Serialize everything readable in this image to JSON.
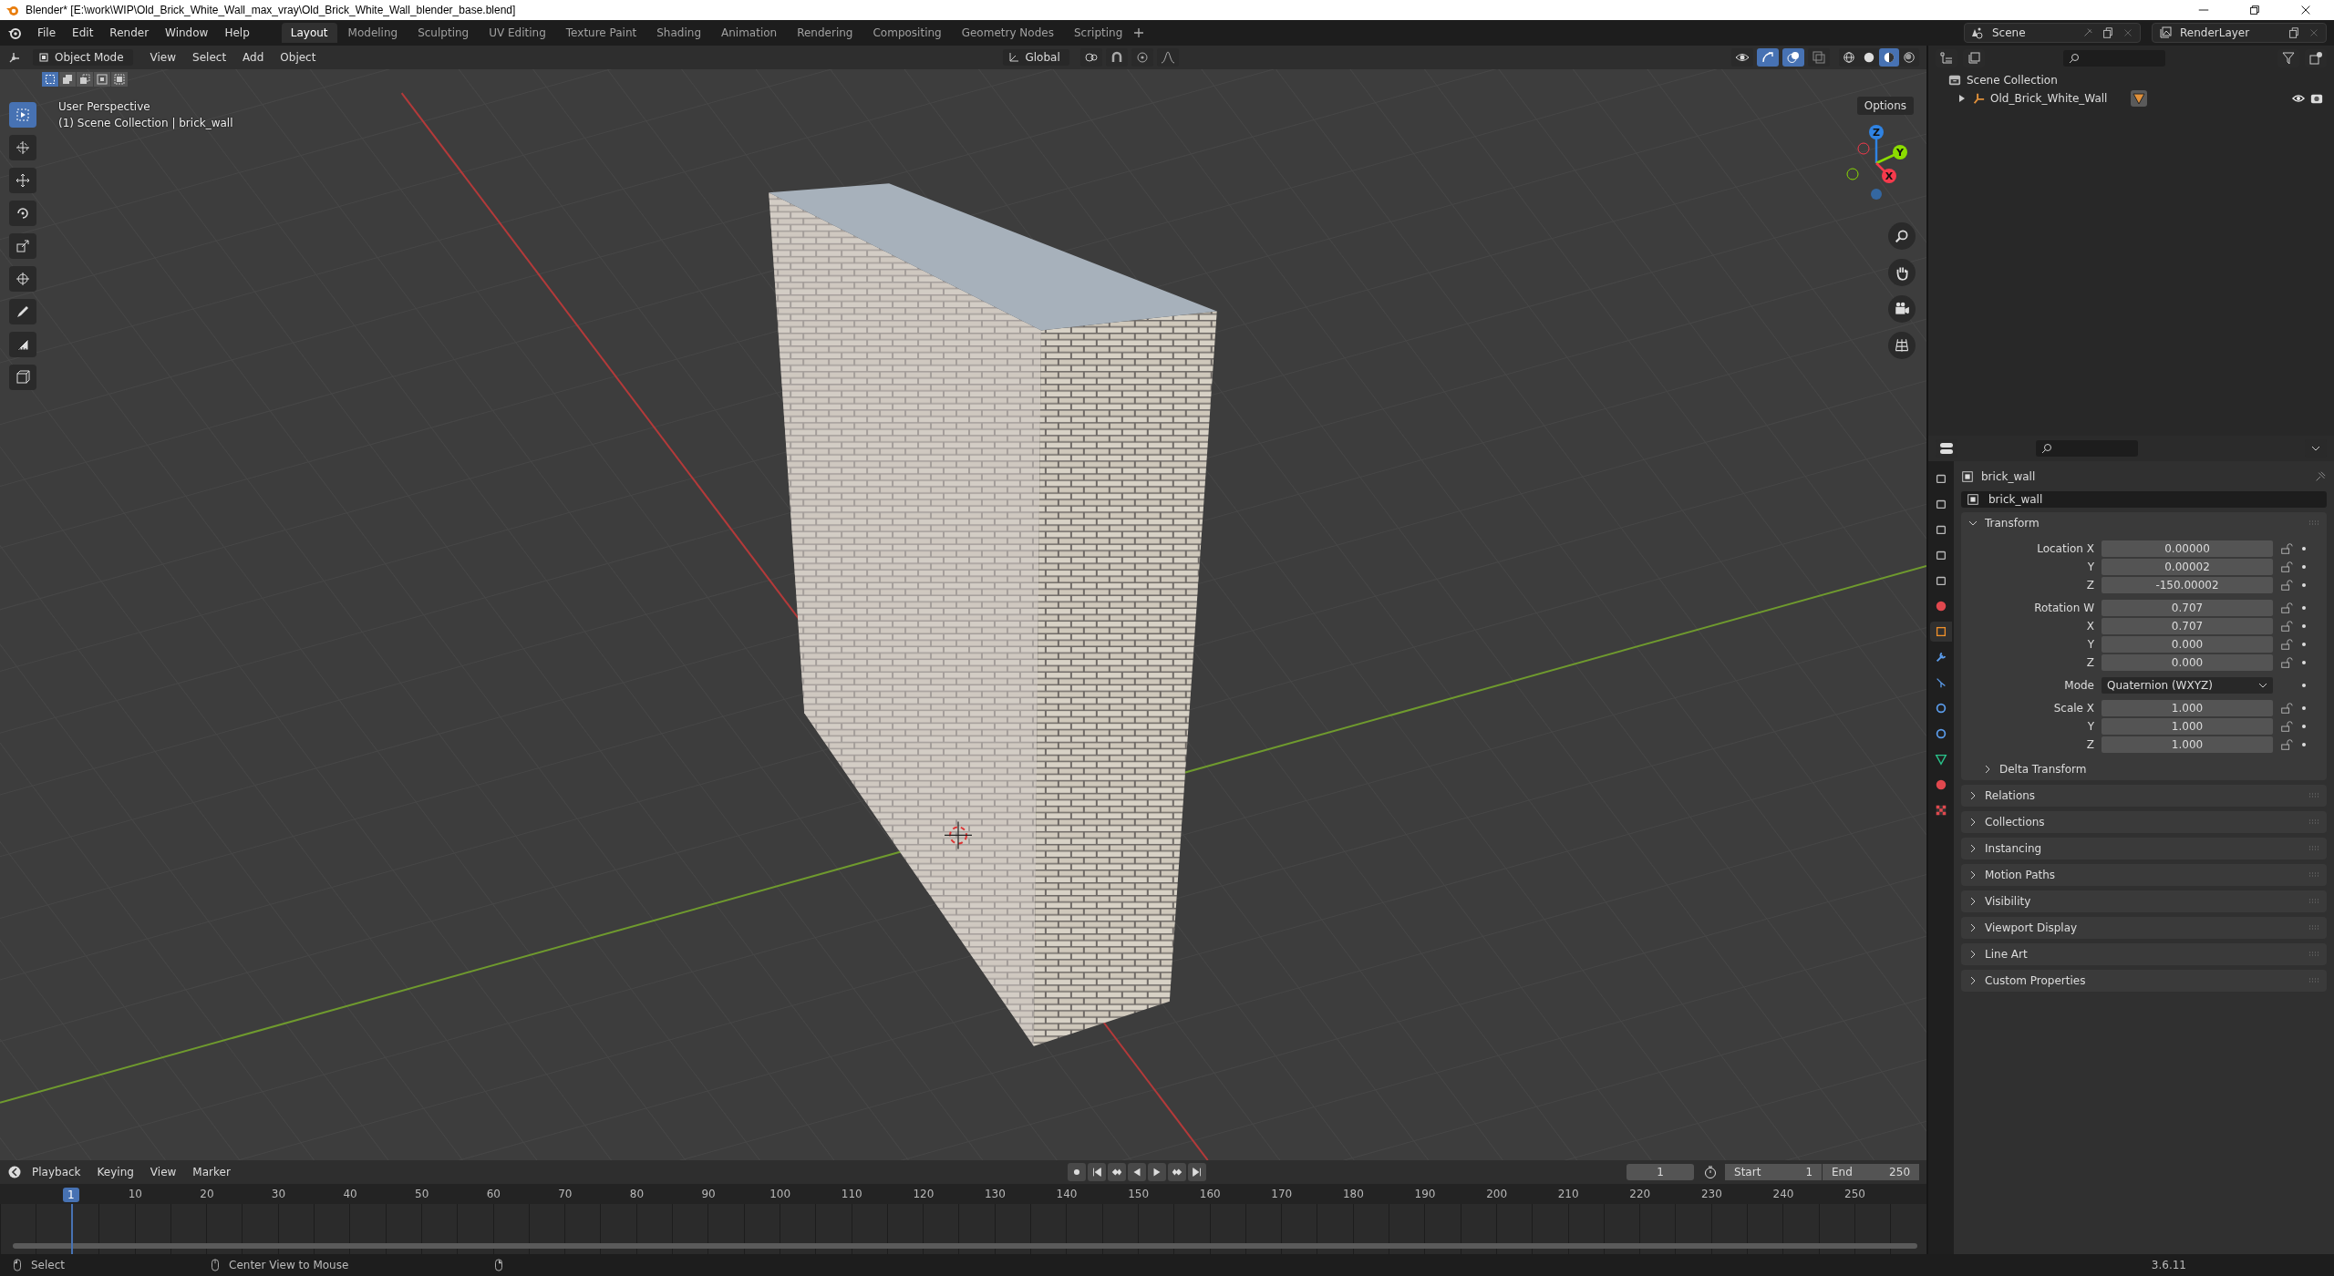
{
  "window": {
    "title": "Blender* [E:\\work\\WIP\\Old_Brick_White_Wall_max_vray\\Old_Brick_White_Wall_blender_base.blend]"
  },
  "menu": [
    "File",
    "Edit",
    "Render",
    "Window",
    "Help"
  ],
  "workspaces": [
    {
      "label": "Layout",
      "selected": true
    },
    {
      "label": "Modeling",
      "selected": false
    },
    {
      "label": "Sculpting",
      "selected": false
    },
    {
      "label": "UV Editing",
      "selected": false
    },
    {
      "label": "Texture Paint",
      "selected": false
    },
    {
      "label": "Shading",
      "selected": false
    },
    {
      "label": "Animation",
      "selected": false
    },
    {
      "label": "Rendering",
      "selected": false
    },
    {
      "label": "Compositing",
      "selected": false
    },
    {
      "label": "Geometry Nodes",
      "selected": false
    },
    {
      "label": "Scripting",
      "selected": false
    }
  ],
  "scene": "Scene",
  "view_layer": "RenderLayer",
  "viewport": {
    "mode": "Object Mode",
    "menus": [
      "View",
      "Select",
      "Add",
      "Object"
    ],
    "orientation": "Global",
    "options": "Options",
    "select_modes": [
      {
        "kind": "set",
        "selected": true
      },
      {
        "kind": "extend",
        "selected": false
      },
      {
        "kind": "subtract",
        "selected": false
      },
      {
        "kind": "difference",
        "selected": false
      },
      {
        "kind": "intersect",
        "selected": false
      }
    ],
    "shading": [
      {
        "kind": "wireframe",
        "selected": false
      },
      {
        "kind": "solid",
        "selected": false
      },
      {
        "kind": "material",
        "selected": true
      },
      {
        "kind": "rendered",
        "selected": false
      }
    ],
    "info": [
      "User Perspective",
      "(1) Scene Collection | brick_wall"
    ],
    "tools": [
      {
        "kind": "select",
        "selected": true
      },
      {
        "kind": "cursor",
        "selected": false
      },
      {
        "kind": "move",
        "selected": false
      },
      {
        "kind": "rotate",
        "selected": false
      },
      {
        "kind": "scale",
        "selected": false
      },
      {
        "kind": "transform",
        "selected": false
      },
      {
        "kind": "annotate",
        "selected": false
      },
      {
        "kind": "measure",
        "selected": false
      },
      {
        "kind": "add_cube",
        "selected": false
      }
    ],
    "gizmo": [
      {
        "label": "Z",
        "color": "#2f83e3"
      },
      {
        "label": "Y",
        "color": "#8bdc00"
      },
      {
        "label": "X",
        "color": "#f53a4c"
      }
    ]
  },
  "outliner": {
    "items": [
      {
        "label": "Scene Collection",
        "kind": "collection",
        "children": [
          {
            "label": "Old_Brick_White_Wall",
            "kind": "empty",
            "expanded": false
          }
        ]
      }
    ]
  },
  "properties": {
    "tabs": [
      {
        "kind": "tool",
        "selected": false
      },
      {
        "kind": "render",
        "selected": false
      },
      {
        "kind": "output",
        "selected": false
      },
      {
        "kind": "view_layer",
        "selected": false
      },
      {
        "kind": "scene",
        "selected": false
      },
      {
        "kind": "world",
        "selected": false
      },
      {
        "kind": "object",
        "selected": true
      },
      {
        "kind": "modifiers",
        "selected": false
      },
      {
        "kind": "particles",
        "selected": false
      },
      {
        "kind": "physics",
        "selected": false
      },
      {
        "kind": "constraints",
        "selected": false
      },
      {
        "kind": "data",
        "selected": false
      },
      {
        "kind": "material",
        "selected": false
      },
      {
        "kind": "texture",
        "selected": false
      }
    ],
    "object": "brick_wall",
    "data": "brick_wall",
    "panels": [
      {
        "title": "Transform",
        "expanded": true,
        "groups": [
          {
            "rows": [
              {
                "kind": "number",
                "label": "Location X",
                "value": "0.00000"
              },
              {
                "kind": "number",
                "label": "Y",
                "value": "0.00002"
              },
              {
                "kind": "number",
                "label": "Z",
                "value": "-150.00002"
              }
            ]
          },
          {
            "rows": [
              {
                "kind": "number",
                "label": "Rotation W",
                "value": "0.707"
              },
              {
                "kind": "number",
                "label": "X",
                "value": "0.707"
              },
              {
                "kind": "number",
                "label": "Y",
                "value": "0.000"
              },
              {
                "kind": "number",
                "label": "Z",
                "value": "0.000"
              }
            ]
          },
          {
            "rows": [
              {
                "kind": "dropdown",
                "label": "Mode",
                "value": "Quaternion (WXYZ)"
              }
            ]
          },
          {
            "rows": [
              {
                "kind": "number",
                "label": "Scale X",
                "value": "1.000"
              },
              {
                "kind": "number",
                "label": "Y",
                "value": "1.000"
              },
              {
                "kind": "number",
                "label": "Z",
                "value": "1.000"
              }
            ]
          }
        ],
        "subpanels": [
          {
            "title": "Delta Transform",
            "expanded": false
          }
        ]
      },
      {
        "title": "Relations",
        "expanded": false
      },
      {
        "title": "Collections",
        "expanded": false
      },
      {
        "title": "Instancing",
        "expanded": false
      },
      {
        "title": "Motion Paths",
        "expanded": false
      },
      {
        "title": "Visibility",
        "expanded": false
      },
      {
        "title": "Viewport Display",
        "expanded": false
      },
      {
        "title": "Line Art",
        "expanded": false
      },
      {
        "title": "Custom Properties",
        "expanded": false
      }
    ]
  },
  "timeline": {
    "menus": [
      "Playback",
      "Keying",
      "View",
      "Marker"
    ],
    "playhead": "1",
    "current_frame": "1",
    "start_label": "Start",
    "start": "1",
    "end_label": "End",
    "end": "250",
    "ticks": [
      "10",
      "20",
      "30",
      "40",
      "50",
      "60",
      "70",
      "80",
      "90",
      "100",
      "110",
      "120",
      "130",
      "140",
      "150",
      "160",
      "170",
      "180",
      "190",
      "200",
      "210",
      "220",
      "230",
      "240",
      "250"
    ]
  },
  "status": {
    "items": [
      "Select",
      "Center View to Mouse"
    ],
    "version": "3.6.11"
  }
}
